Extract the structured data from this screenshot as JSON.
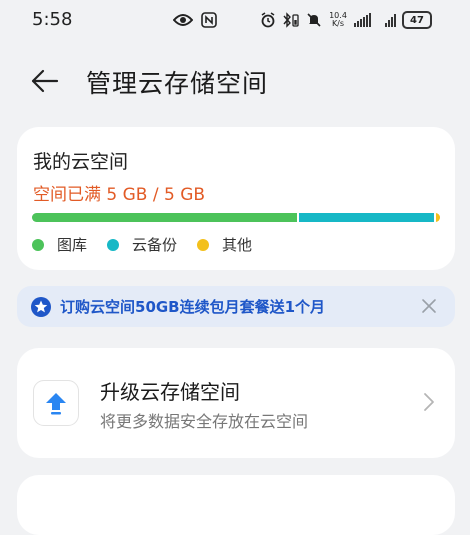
{
  "status_bar": {
    "time": "5:58",
    "net_speed_value": "10.4",
    "net_speed_unit": "K/s",
    "battery": "47"
  },
  "header": {
    "title": "管理云存储空间"
  },
  "storage": {
    "title": "我的云空间",
    "usage_text": "空间已满 5 GB / 5 GB",
    "segments": [
      {
        "name": "gallery",
        "fraction": 0.655,
        "color": "#4cc35a"
      },
      {
        "name": "backup",
        "fraction": 0.335,
        "color": "#17b8c6"
      },
      {
        "name": "other",
        "fraction": 0.01,
        "color": "#f3c01c"
      }
    ],
    "legend": [
      {
        "label": "图库",
        "color": "#4cc35a"
      },
      {
        "label": "云备份",
        "color": "#17b8c6"
      },
      {
        "label": "其他",
        "color": "#f3c01c"
      }
    ]
  },
  "promo": {
    "text": "订购云空间50GB连续包月套餐送1个月",
    "accent": "#1f57c8"
  },
  "upgrade": {
    "title": "升级云存储空间",
    "subtitle": "将更多数据安全存放在云空间"
  }
}
